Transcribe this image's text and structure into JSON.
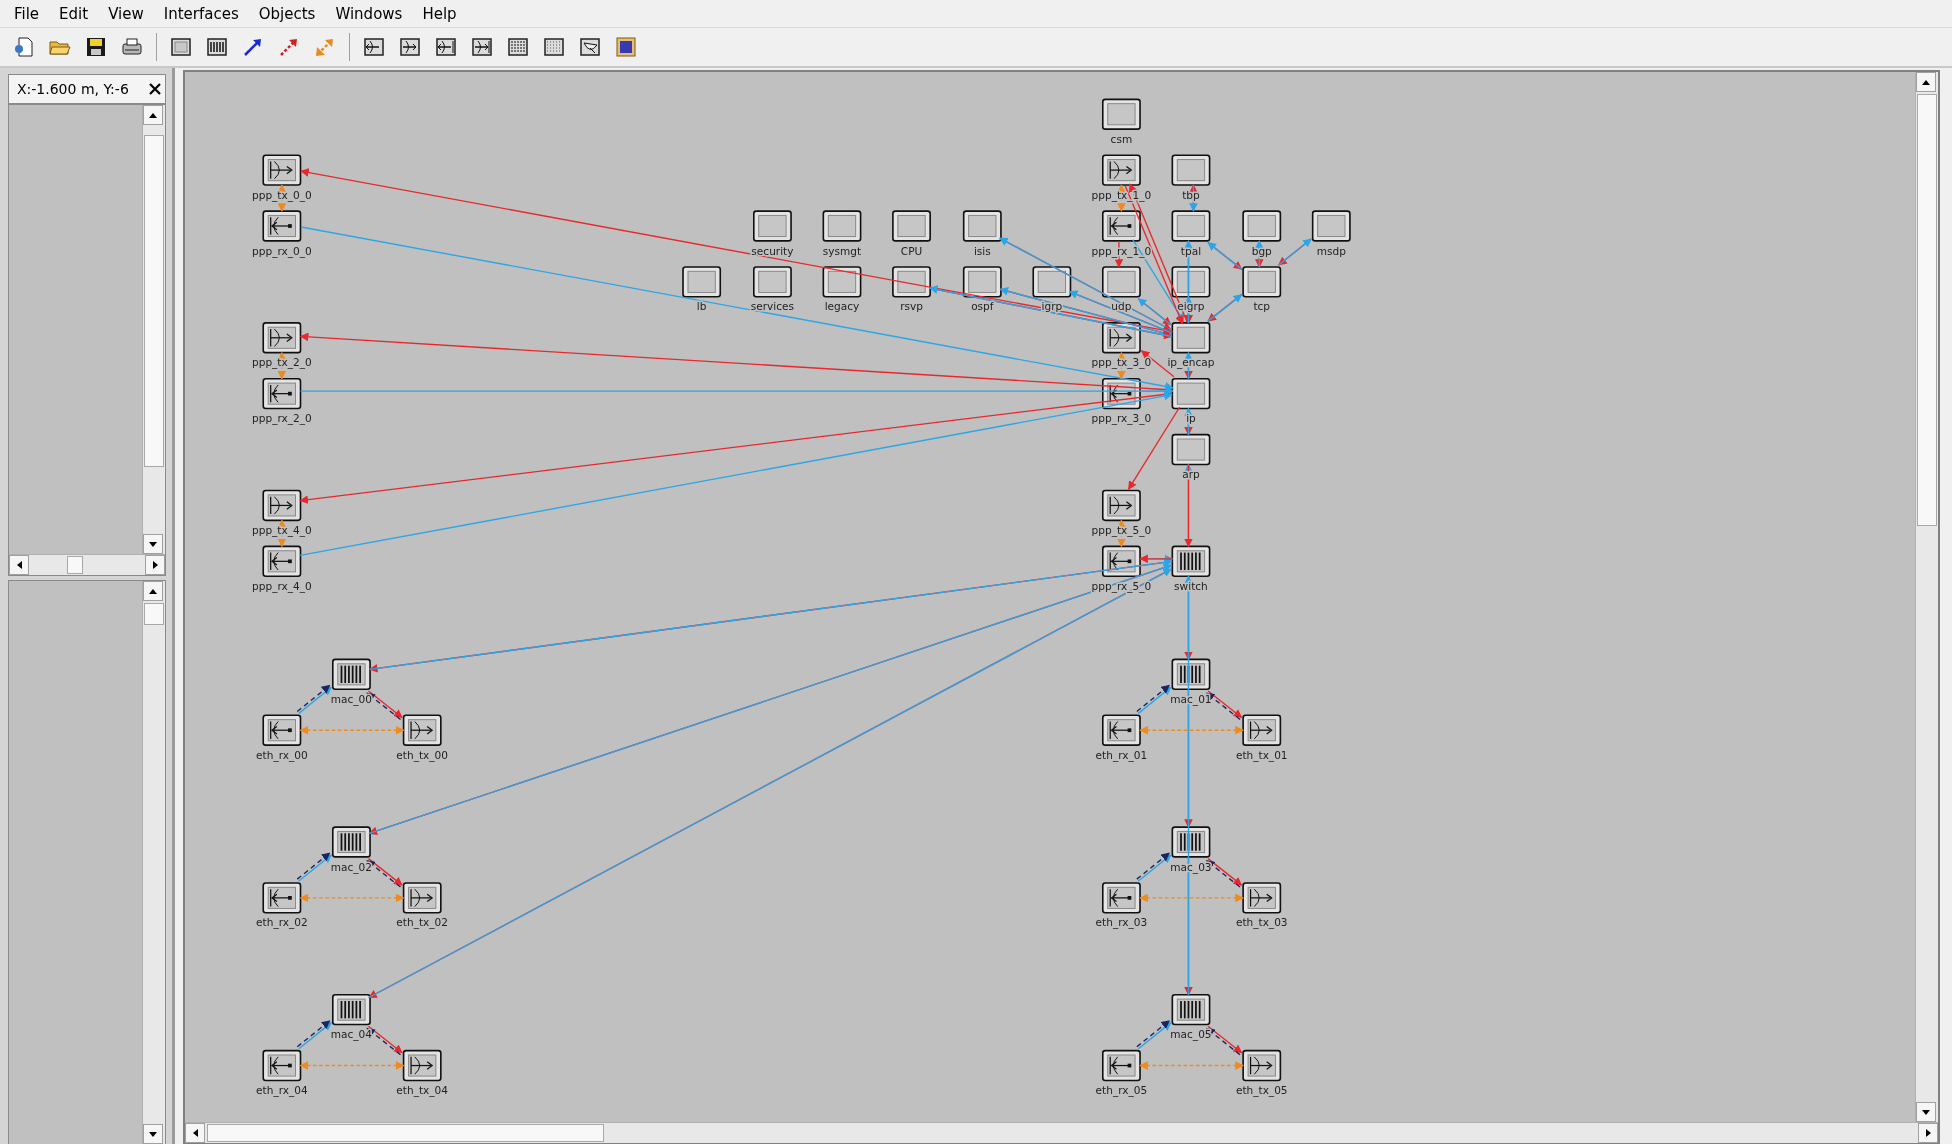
{
  "menu": [
    "File",
    "Edit",
    "View",
    "Interfaces",
    "Objects",
    "Windows",
    "Help"
  ],
  "coordinates": "X:-1.600 m, Y:-6",
  "nodes": [
    {
      "label": "csm",
      "kind": "processor"
    },
    {
      "label": "ppp_tx_0_0",
      "kind": "transmitter"
    },
    {
      "label": "ppp_tx_1_0",
      "kind": "transmitter"
    },
    {
      "label": "tbp",
      "kind": "processor"
    },
    {
      "label": "ppp_rx_0_0",
      "kind": "receiver"
    },
    {
      "label": "security",
      "kind": "processor"
    },
    {
      "label": "sysmgt",
      "kind": "processor"
    },
    {
      "label": "CPU",
      "kind": "processor"
    },
    {
      "label": "isis",
      "kind": "processor"
    },
    {
      "label": "ppp_rx_1_0",
      "kind": "receiver"
    },
    {
      "label": "tpal",
      "kind": "processor"
    },
    {
      "label": "bgp",
      "kind": "processor"
    },
    {
      "label": "msdp",
      "kind": "processor"
    },
    {
      "label": "lb",
      "kind": "processor"
    },
    {
      "label": "services",
      "kind": "processor"
    },
    {
      "label": "legacy",
      "kind": "processor"
    },
    {
      "label": "rsvp",
      "kind": "processor"
    },
    {
      "label": "ospf",
      "kind": "processor"
    },
    {
      "label": "igrp",
      "kind": "processor"
    },
    {
      "label": "udp",
      "kind": "processor"
    },
    {
      "label": "eigrp",
      "kind": "processor"
    },
    {
      "label": "tcp",
      "kind": "processor"
    },
    {
      "label": "ppp_tx_2_0",
      "kind": "transmitter"
    },
    {
      "label": "ppp_tx_3_0",
      "kind": "transmitter"
    },
    {
      "label": "ip_encap",
      "kind": "processor"
    },
    {
      "label": "ppp_rx_2_0",
      "kind": "receiver"
    },
    {
      "label": "ppp_rx_3_0",
      "kind": "receiver"
    },
    {
      "label": "ip",
      "kind": "processor"
    },
    {
      "label": "arp",
      "kind": "processor"
    },
    {
      "label": "ppp_tx_4_0",
      "kind": "transmitter"
    },
    {
      "label": "ppp_tx_5_0",
      "kind": "transmitter"
    },
    {
      "label": "ppp_rx_4_0",
      "kind": "receiver"
    },
    {
      "label": "ppp_rx_5_0",
      "kind": "receiver"
    },
    {
      "label": "switch",
      "kind": "queue"
    },
    {
      "label": "mac_00",
      "kind": "queue"
    },
    {
      "label": "mac_01",
      "kind": "queue"
    },
    {
      "label": "eth_rx_00",
      "kind": "receiver"
    },
    {
      "label": "eth_tx_00",
      "kind": "transmitter"
    },
    {
      "label": "eth_rx_01",
      "kind": "receiver"
    },
    {
      "label": "eth_tx_01",
      "kind": "transmitter"
    },
    {
      "label": "mac_02",
      "kind": "queue"
    },
    {
      "label": "mac_03",
      "kind": "queue"
    },
    {
      "label": "eth_rx_02",
      "kind": "receiver"
    },
    {
      "label": "eth_tx_02",
      "kind": "transmitter"
    },
    {
      "label": "eth_rx_03",
      "kind": "receiver"
    },
    {
      "label": "eth_tx_03",
      "kind": "transmitter"
    },
    {
      "label": "mac_04",
      "kind": "queue"
    },
    {
      "label": "mac_05",
      "kind": "queue"
    },
    {
      "label": "eth_rx_04",
      "kind": "receiver"
    },
    {
      "label": "eth_tx_04",
      "kind": "transmitter"
    },
    {
      "label": "eth_rx_05",
      "kind": "receiver"
    },
    {
      "label": "eth_tx_05",
      "kind": "transmitter"
    }
  ]
}
